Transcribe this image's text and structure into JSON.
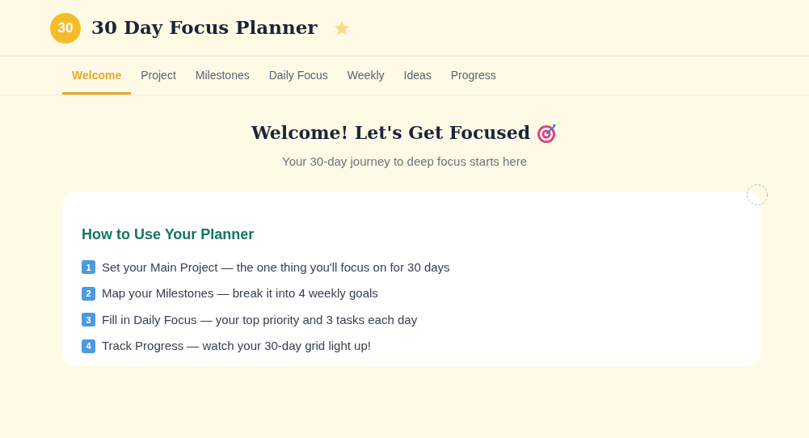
{
  "header": {
    "logo": "30",
    "title": "30 Day Focus Planner"
  },
  "tabs": [
    {
      "label": "Welcome",
      "selected": true
    },
    {
      "label": "Project",
      "selected": false
    },
    {
      "label": "Milestones",
      "selected": false
    },
    {
      "label": "Daily Focus",
      "selected": false
    },
    {
      "label": "Weekly",
      "selected": false
    },
    {
      "label": "Ideas",
      "selected": false
    },
    {
      "label": "Progress",
      "selected": false
    }
  ],
  "hero": {
    "title": "Welcome! Let's Get Focused",
    "subtitle": "Your 30-day journey to deep focus starts here"
  },
  "card": {
    "title": "How to Use Your Planner",
    "steps": [
      {
        "number": "1",
        "text": "Set your Main Project — the one thing you'll focus on for 30 days"
      },
      {
        "number": "2",
        "text": "Map your Milestones — break it into 4 weekly goals"
      },
      {
        "number": "3",
        "text": "Fill in Daily Focus — your top priority and 3 tasks each day"
      },
      {
        "number": "4",
        "text": "Track Progress — watch your 30-day grid light up!"
      }
    ]
  }
}
